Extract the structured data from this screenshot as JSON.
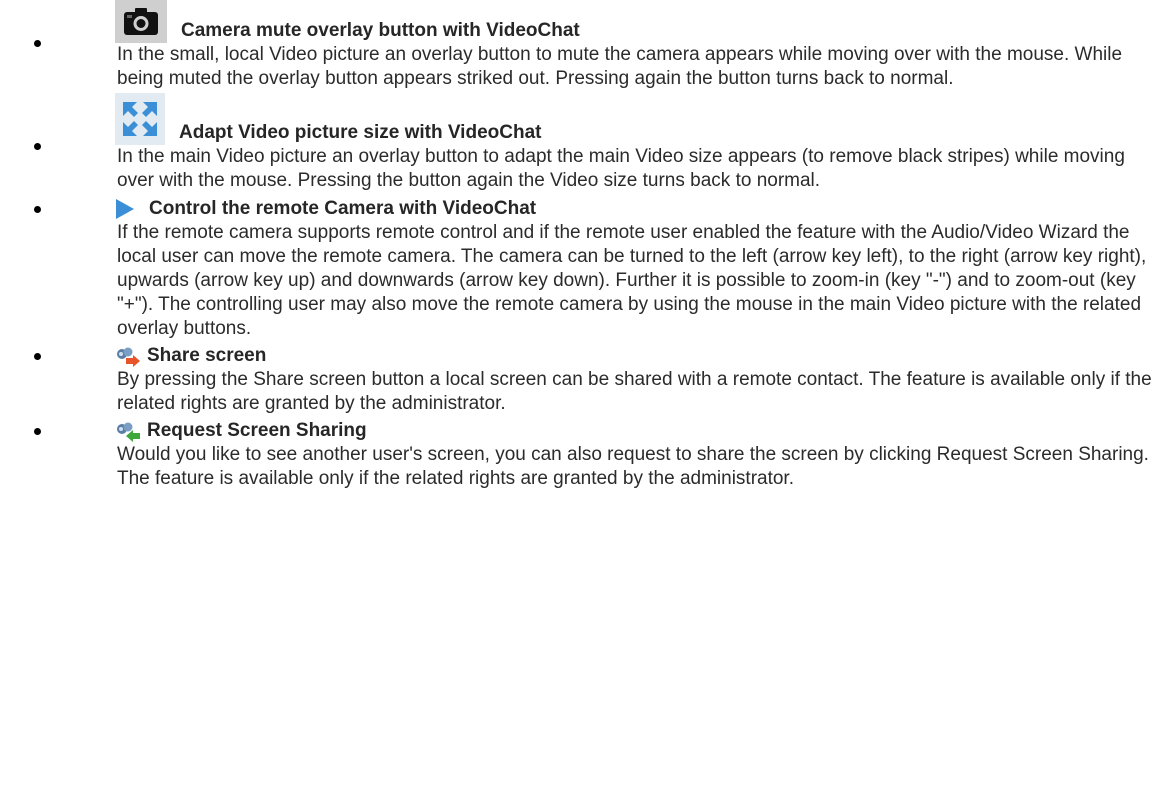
{
  "items": [
    {
      "icon": "camera-icon",
      "title": "Camera mute overlay button with VideoChat",
      "description": "In the small, local Video picture an overlay button to mute the camera appears while moving over with the mouse. While being muted the overlay button appears striked out. Pressing again the button turns back to normal."
    },
    {
      "icon": "expand-arrows-icon",
      "title": "Adapt Video picture size with VideoChat",
      "description": "In the main Video picture an overlay button to adapt the main Video size appears (to remove black stripes) while moving over with the mouse. Pressing the button again the Video size turns back to normal."
    },
    {
      "icon": "play-triangle-icon",
      "title": "Control the remote Camera with VideoChat",
      "description": "If the remote camera supports remote control and if the remote user enabled the feature with the Audio/Video Wizard the local user can move the remote camera. The camera can be turned to the left (arrow key left), to the right (arrow key right), upwards (arrow key up) and downwards (arrow key down). Further it is possible to zoom-in (key \"-\") and to zoom-out (key \"+\"). The controlling user may also move the remote camera by using the mouse in the main Video picture with the related overlay buttons."
    },
    {
      "icon": "share-screen-icon",
      "title": "Share screen",
      "description": "By pressing the Share screen button a local screen can be shared with a remote contact. The feature is available only if the related rights are granted by the administrator."
    },
    {
      "icon": "request-screen-icon",
      "title": "Request Screen Sharing",
      "description": "Would you like to see another user's screen, you can also request to share the screen by clicking Request Screen Sharing. The feature is available only if the related rights are granted by the administrator."
    }
  ],
  "colors": {
    "accent_blue": "#3b8fd6",
    "share_orange": "#e8542a",
    "request_green": "#3fa83a"
  }
}
